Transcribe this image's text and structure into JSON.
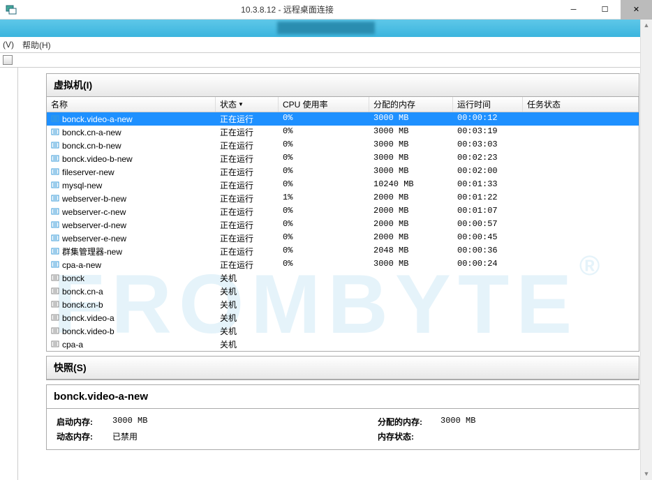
{
  "window": {
    "title": "10.3.8.12 - 远程桌面连接"
  },
  "menu": {
    "v": "(V)",
    "help": "帮助(H)"
  },
  "vm_panel": {
    "title": "虚拟机(I)"
  },
  "columns": {
    "name": "名称",
    "state": "状态",
    "cpu": "CPU 使用率",
    "mem": "分配的内存",
    "time": "运行时间",
    "task": "任务状态"
  },
  "vms": [
    {
      "name": "bonck.video-a-new",
      "state": "正在运行",
      "cpu": "0%",
      "mem": "3000 MB",
      "time": "00:00:12",
      "selected": true
    },
    {
      "name": "bonck.cn-a-new",
      "state": "正在运行",
      "cpu": "0%",
      "mem": "3000 MB",
      "time": "00:03:19"
    },
    {
      "name": "bonck.cn-b-new",
      "state": "正在运行",
      "cpu": "0%",
      "mem": "3000 MB",
      "time": "00:03:03"
    },
    {
      "name": "bonck.video-b-new",
      "state": "正在运行",
      "cpu": "0%",
      "mem": "3000 MB",
      "time": "00:02:23"
    },
    {
      "name": "fileserver-new",
      "state": "正在运行",
      "cpu": "0%",
      "mem": "3000 MB",
      "time": "00:02:00"
    },
    {
      "name": "mysql-new",
      "state": "正在运行",
      "cpu": "0%",
      "mem": "10240 MB",
      "time": "00:01:33"
    },
    {
      "name": "webserver-b-new",
      "state": "正在运行",
      "cpu": "1%",
      "mem": "2000 MB",
      "time": "00:01:22"
    },
    {
      "name": "webserver-c-new",
      "state": "正在运行",
      "cpu": "0%",
      "mem": "2000 MB",
      "time": "00:01:07"
    },
    {
      "name": "webserver-d-new",
      "state": "正在运行",
      "cpu": "0%",
      "mem": "2000 MB",
      "time": "00:00:57"
    },
    {
      "name": "webserver-e-new",
      "state": "正在运行",
      "cpu": "0%",
      "mem": "2000 MB",
      "time": "00:00:45"
    },
    {
      "name": "群集管理器-new",
      "state": "正在运行",
      "cpu": "0%",
      "mem": "2048 MB",
      "time": "00:00:36"
    },
    {
      "name": "cpa-a-new",
      "state": "正在运行",
      "cpu": "0%",
      "mem": "3000 MB",
      "time": "00:00:24"
    },
    {
      "name": "bonck",
      "state": "关机",
      "cpu": "",
      "mem": "",
      "time": ""
    },
    {
      "name": "bonck.cn-a",
      "state": "关机",
      "cpu": "",
      "mem": "",
      "time": ""
    },
    {
      "name": "bonck.cn-b",
      "state": "关机",
      "cpu": "",
      "mem": "",
      "time": ""
    },
    {
      "name": "bonck.video-a",
      "state": "关机",
      "cpu": "",
      "mem": "",
      "time": ""
    },
    {
      "name": "bonck.video-b",
      "state": "关机",
      "cpu": "",
      "mem": "",
      "time": ""
    },
    {
      "name": "cpa-a",
      "state": "关机",
      "cpu": "",
      "mem": "",
      "time": ""
    }
  ],
  "snapshot_panel": {
    "title": "快照(S)"
  },
  "details": {
    "title": "bonck.video-a-new",
    "startup_mem_label": "启动内存:",
    "startup_mem": "3000 MB",
    "dynamic_mem_label": "动态内存:",
    "dynamic_mem": "已禁用",
    "alloc_mem_label": "分配的内存:",
    "alloc_mem": "3000 MB",
    "mem_status_label": "内存状态:",
    "mem_status": ""
  },
  "watermark": "FROMBYTE"
}
